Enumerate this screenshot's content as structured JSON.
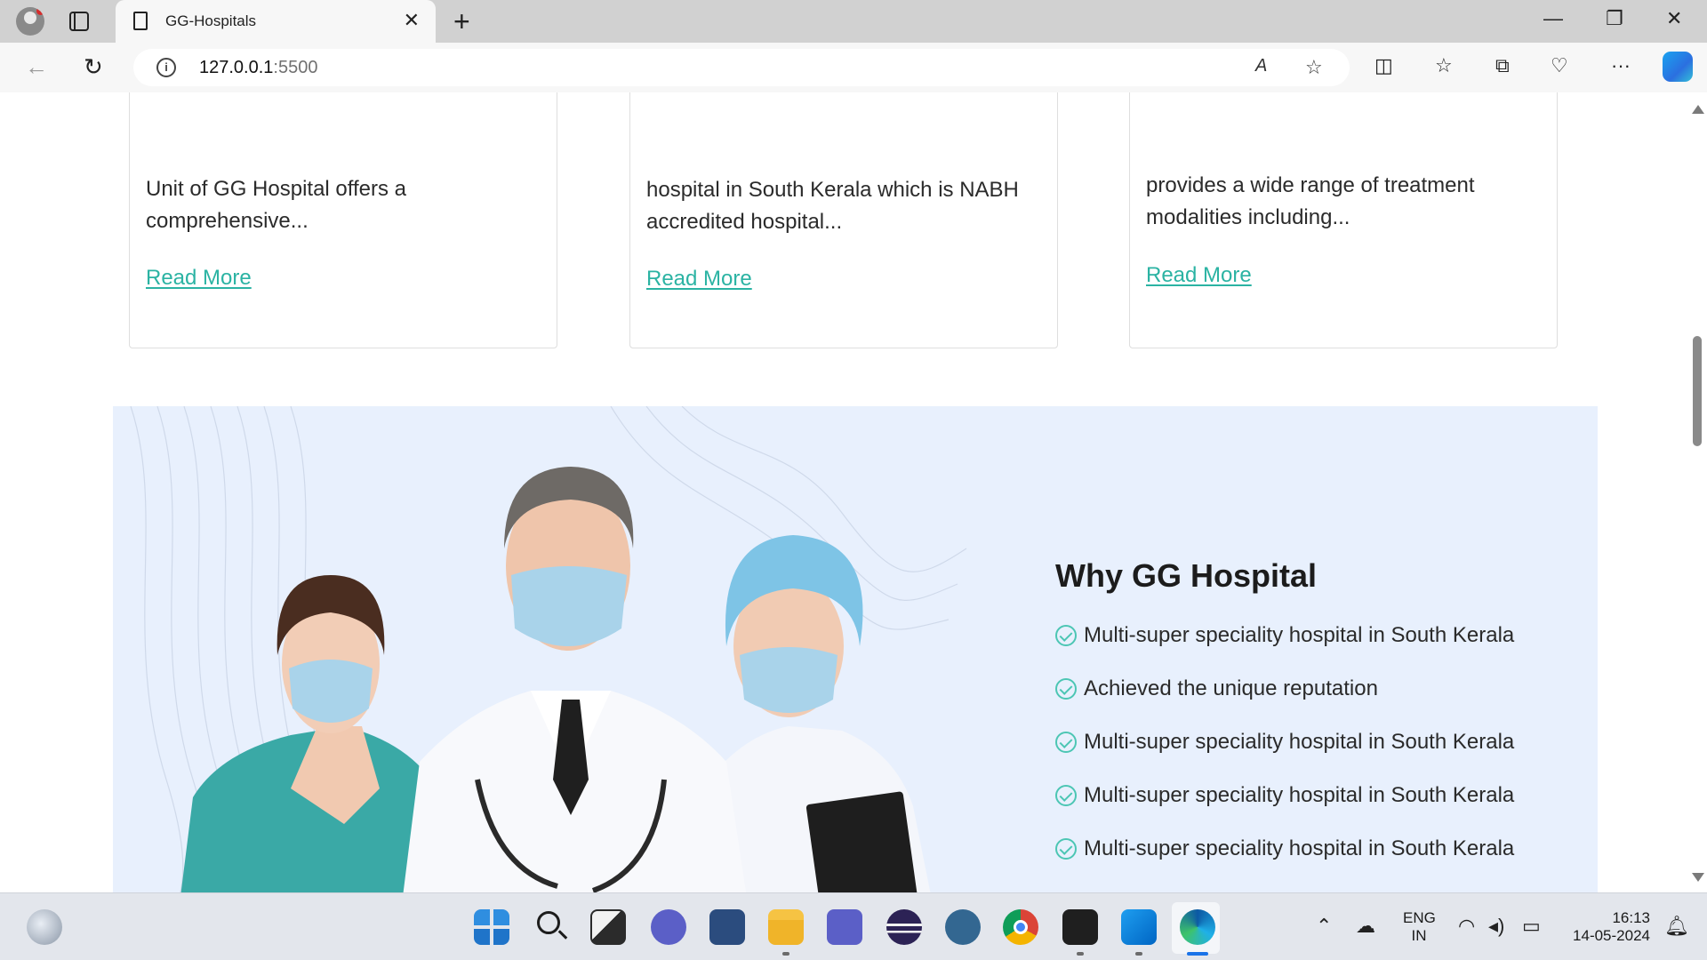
{
  "browser": {
    "tab_title": "GG-Hospitals",
    "close_tab": "✕",
    "new_tab": "+",
    "url_host": "127.0.0.1",
    "url_port": ":5500",
    "window_controls": {
      "minimize": "—",
      "restore": "❐",
      "close": "✕"
    }
  },
  "cards": [
    {
      "desc": "Unit of GG Hospital offers a comprehensive...",
      "link": "Read More"
    },
    {
      "desc": "hospital in South Kerala which is NABH accredited hospital...",
      "link": "Read More"
    },
    {
      "desc": "provides a wide range of treatment modalities including...",
      "link": "Read More"
    }
  ],
  "why": {
    "title": "Why GG Hospital",
    "items": [
      "Multi-super speciality hospital in South Kerala",
      "Achieved the unique reputation",
      "Multi-super speciality hospital in South Kerala",
      "Multi-super speciality hospital in South Kerala",
      "Multi-super speciality hospital in South Kerala"
    ]
  },
  "taskbar": {
    "lang_top": "ENG",
    "lang_bottom": "IN",
    "time": "16:13",
    "date": "14-05-2024"
  },
  "colors": {
    "accent": "#2bb3a3",
    "section_bg": "#e8f0fd",
    "check": "#4cc6b4"
  }
}
